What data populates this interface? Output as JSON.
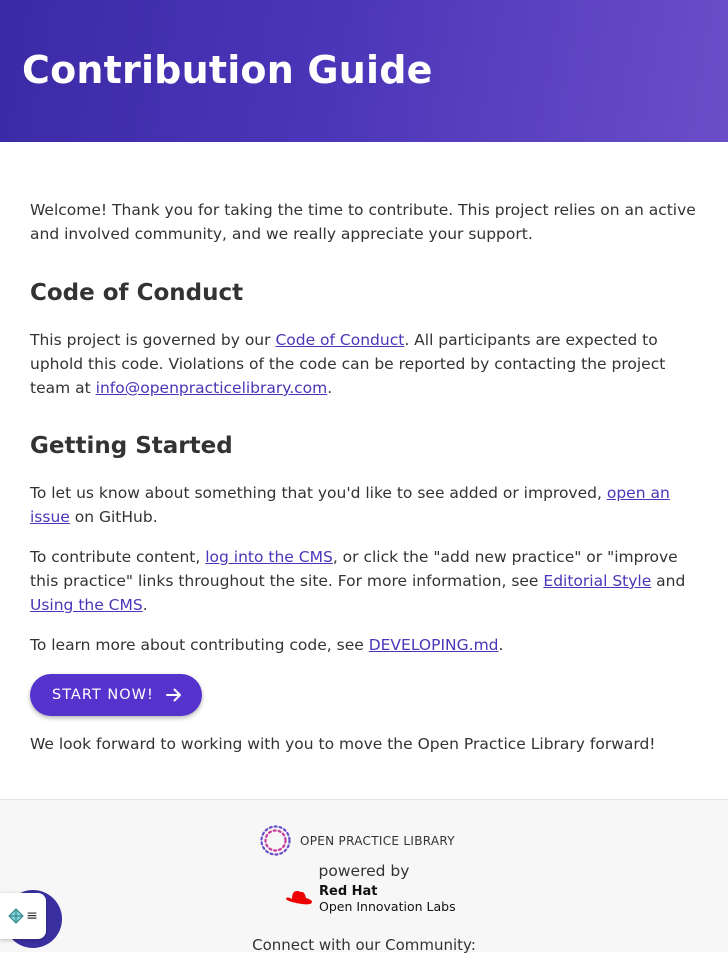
{
  "header": {
    "title": "Contribution Guide"
  },
  "intro": "Welcome! Thank you for taking the time to contribute. This project relies on an active and involved community, and we really appreciate your support.",
  "coc": {
    "heading": "Code of Conduct",
    "text_before": "This project is governed by our ",
    "link_label": "Code of Conduct",
    "text_middle": ". All participants are expected to uphold this code. Violations of the code can be reported by contacting the project team at ",
    "email_link": "info@openpracticelibrary.com",
    "text_after": "."
  },
  "getting_started": {
    "heading": "Getting Started",
    "p1_before": "To let us know about something that you'd like to see added or improved, ",
    "p1_link": "open an issue",
    "p1_after": " on GitHub.",
    "p2_before": "To contribute content, ",
    "p2_link1": "log into the CMS",
    "p2_middle": ", or click the \"add new practice\" or \"improve this practice\" links throughout the site. For more information, see ",
    "p2_link2": "Editorial Style",
    "p2_and": " and ",
    "p2_link3": "Using the CMS",
    "p2_after": ".",
    "p3_before": "To learn more about contributing code, see ",
    "p3_link": "DEVELOPING.md",
    "p3_after": "."
  },
  "cta": {
    "label": "START NOW!",
    "icon": "arrow-right-icon"
  },
  "closing": "We look forward to working with you to move the Open Practice Library forward!",
  "footer": {
    "opl_label": "OPEN PRACTICE LIBRARY",
    "powered_by": "powered by",
    "rh_brand": "Red Hat",
    "rh_labs": "Open Innovation Labs",
    "connect": "Connect with our Community:"
  },
  "colors": {
    "hero_gradient_start": "#3b2aa6",
    "hero_gradient_end": "#6a4ec8",
    "accent": "#5533cc",
    "link": "#4b35b8",
    "redhat_red": "#ee0000"
  }
}
